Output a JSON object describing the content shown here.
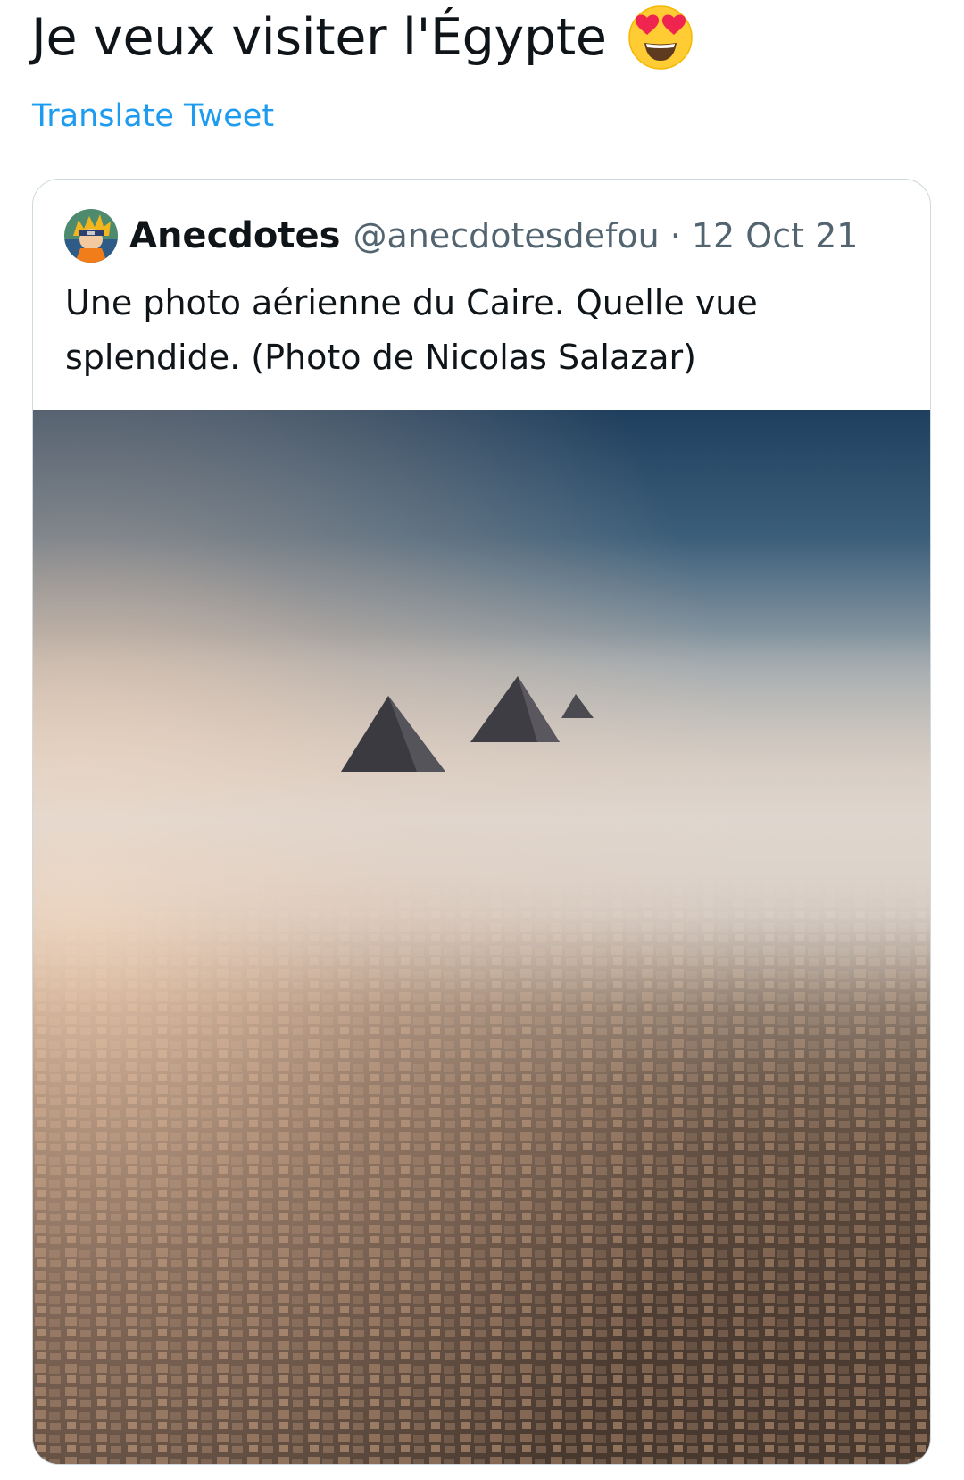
{
  "tweet": {
    "text": "Je veux visiter l'Égypte",
    "emoji_icon": "smiling-face-with-heart-eyes-icon",
    "translate_label": "Translate Tweet"
  },
  "quoted_tweet": {
    "author_name": "Anecdotes",
    "author_handle": "@anecdotesdefou",
    "separator": "·",
    "date": "12 Oct 21",
    "text": "Une photo aérienne du Caire. Quelle vue splendide. (Photo de Nicolas Salazar)",
    "avatar_icon": "cartoon-avatar-icon",
    "media_icon": "aerial-photo-cairo-pyramids"
  },
  "colors": {
    "link": "#1d9bf0",
    "text_primary": "#0f1419",
    "text_secondary": "#536471",
    "border": "#cfd9de"
  }
}
